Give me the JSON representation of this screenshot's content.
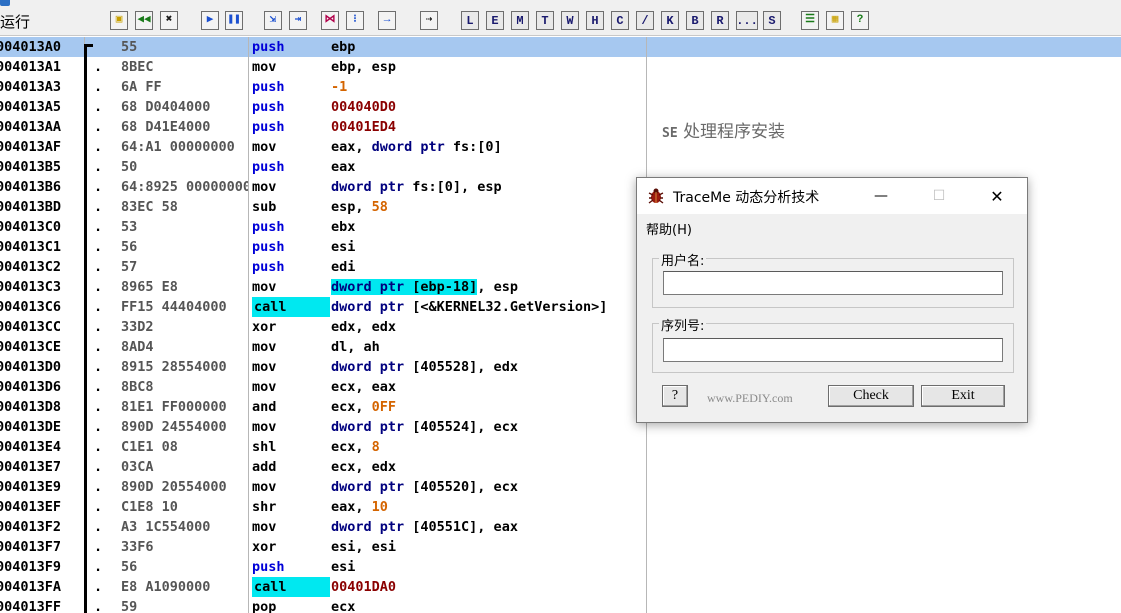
{
  "toolbar": {
    "title": "运行",
    "letter_buttons": [
      "L",
      "E",
      "M",
      "T",
      "W",
      "H",
      "C",
      "/",
      "K",
      "B",
      "R",
      "...",
      "S"
    ]
  },
  "disassembly": {
    "rows": [
      {
        "addr": "004013A0",
        "hex": "55",
        "mnem": "push",
        "op": "ebp",
        "mnem_style": "blue",
        "selected": true
      },
      {
        "addr": "004013A1",
        "hex": "8BEC",
        "mnem": "mov",
        "op": "ebp, esp"
      },
      {
        "addr": "004013A3",
        "hex": "6A FF",
        "mnem": "push",
        "op": "-1",
        "mnem_style": "blue"
      },
      {
        "addr": "004013A5",
        "hex": "68 D0404000",
        "mnem": "push",
        "op": "004040D0",
        "mnem_style": "blue"
      },
      {
        "addr": "004013AA",
        "hex": "68 D41E4000",
        "mnem": "push",
        "op": "00401ED4",
        "mnem_style": "blue"
      },
      {
        "addr": "004013AF",
        "hex": "64:A1 00000000",
        "mnem": "mov",
        "op": "eax, dword ptr fs:[0]"
      },
      {
        "addr": "004013B5",
        "hex": "50",
        "mnem": "push",
        "op": "eax",
        "mnem_style": "blue"
      },
      {
        "addr": "004013B6",
        "hex": "64:8925 00000000",
        "mnem": "mov",
        "op": "dword ptr fs:[0], esp"
      },
      {
        "addr": "004013BD",
        "hex": "83EC 58",
        "mnem": "sub",
        "op": "esp, 58"
      },
      {
        "addr": "004013C0",
        "hex": "53",
        "mnem": "push",
        "op": "ebx",
        "mnem_style": "blue"
      },
      {
        "addr": "004013C1",
        "hex": "56",
        "mnem": "push",
        "op": "esi",
        "mnem_style": "blue"
      },
      {
        "addr": "004013C2",
        "hex": "57",
        "mnem": "push",
        "op": "edi",
        "mnem_style": "blue"
      },
      {
        "addr": "004013C3",
        "hex": "8965 E8",
        "mnem": "mov",
        "op": "dword ptr [ebp-18], esp"
      },
      {
        "addr": "004013C6",
        "hex": "FF15 44404000",
        "mnem": "call",
        "op": "dword ptr [<&KERNEL32.GetVersion>]",
        "mnem_style": "hl"
      },
      {
        "addr": "004013CC",
        "hex": "33D2",
        "mnem": "xor",
        "op": "edx, edx"
      },
      {
        "addr": "004013CE",
        "hex": "8AD4",
        "mnem": "mov",
        "op": "dl, ah"
      },
      {
        "addr": "004013D0",
        "hex": "8915 28554000",
        "mnem": "mov",
        "op": "dword ptr [405528], edx"
      },
      {
        "addr": "004013D6",
        "hex": "8BC8",
        "mnem": "mov",
        "op": "ecx, eax"
      },
      {
        "addr": "004013D8",
        "hex": "81E1 FF000000",
        "mnem": "and",
        "op": "ecx, 0FF"
      },
      {
        "addr": "004013DE",
        "hex": "890D 24554000",
        "mnem": "mov",
        "op": "dword ptr [405524], ecx"
      },
      {
        "addr": "004013E4",
        "hex": "C1E1 08",
        "mnem": "shl",
        "op": "ecx, 8"
      },
      {
        "addr": "004013E7",
        "hex": "03CA",
        "mnem": "add",
        "op": "ecx, edx"
      },
      {
        "addr": "004013E9",
        "hex": "890D 20554000",
        "mnem": "mov",
        "op": "dword ptr [405520], ecx"
      },
      {
        "addr": "004013EF",
        "hex": "C1E8 10",
        "mnem": "shr",
        "op": "eax, 10"
      },
      {
        "addr": "004013F2",
        "hex": "A3 1C554000",
        "mnem": "mov",
        "op": "dword ptr [40551C], eax"
      },
      {
        "addr": "004013F7",
        "hex": "33F6",
        "mnem": "xor",
        "op": "esi, esi"
      },
      {
        "addr": "004013F9",
        "hex": "56",
        "mnem": "push",
        "op": "esi",
        "mnem_style": "blue"
      },
      {
        "addr": "004013FA",
        "hex": "E8 A1090000",
        "mnem": "call",
        "op": "00401DA0",
        "mnem_style": "hl"
      },
      {
        "addr": "004013FF",
        "hex": "59",
        "mnem": "pop",
        "op": "ecx"
      }
    ]
  },
  "comments": {
    "se_prefix": "SE",
    "se_text": "处理程序安装"
  },
  "dialog": {
    "title": "TraceMe 动态分析技术",
    "menu_help": "帮助(H)",
    "username_label": "用户名:",
    "serial_label": "序列号:",
    "question_button": "?",
    "watermark": "www.PEDIY.com",
    "check_button": "Check",
    "exit_button": "Exit",
    "min_glyph": "—",
    "max_glyph": "☐",
    "close_glyph": "✕"
  },
  "colors": {
    "selected_row": "#a6c8f0",
    "call_highlight": "#00e8f0",
    "push_blue": "#0000d8",
    "constant_orange": "#d46400",
    "address_red": "#8a0000"
  }
}
